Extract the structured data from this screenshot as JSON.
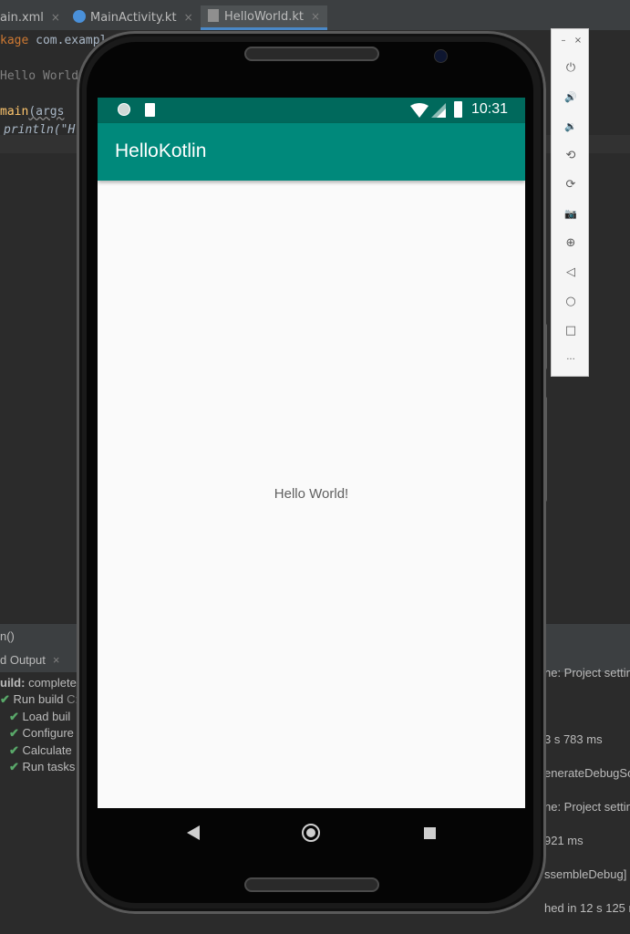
{
  "ide": {
    "tabs": [
      {
        "label": "ain.xml",
        "close": "×"
      },
      {
        "label": "MainActivity.kt",
        "close": "×"
      },
      {
        "label": "HelloWorld.kt",
        "close": "×"
      }
    ],
    "code": {
      "line1_kw": "kage",
      "line1_rest": " com.example",
      "line2": "Hello World",
      "line3_fn": "main",
      "line3_args": "(args",
      "line4": "println(\"H"
    },
    "bottom": {
      "crumb": "n()",
      "output_tab": "d Output",
      "output_close": "×",
      "build_status_label": "uild:",
      "build_status_value": "complete",
      "run_build": "Run build",
      "run_build_path": "C:",
      "tasks": [
        "Load buil",
        "Configure",
        "Calculate",
        "Run tasks"
      ],
      "right_lines": [
        "ne: Project settin",
        "3 s 783 ms",
        "enerateDebugSo",
        "ne: Project settin",
        "921 ms",
        "ssembleDebug] (",
        "hed in 12 s 125 ms"
      ]
    }
  },
  "emulator": {
    "panel_icons": [
      "minimize-icon",
      "close-icon",
      "power-icon",
      "volume-up-icon",
      "volume-down-icon",
      "rotate-left-icon",
      "rotate-right-icon",
      "camera-icon",
      "zoom-icon",
      "back-icon",
      "home-icon",
      "overview-icon",
      "more-icon"
    ],
    "panel_glyphs": {
      "minimize": "–",
      "close": "×",
      "power": "⏻",
      "vol_up": "🔊",
      "vol_down": "🔉",
      "rot_left": "⟲",
      "rot_right": "⟳",
      "camera": "📷",
      "zoom": "⊕",
      "back": "◁",
      "home": "○",
      "overview": "□",
      "more": "···"
    },
    "status_time": "10:31",
    "app_title": "HelloKotlin",
    "hello_text": "Hello World!",
    "colors": {
      "status_bar": "#00695c",
      "app_bar": "#00897b"
    }
  }
}
